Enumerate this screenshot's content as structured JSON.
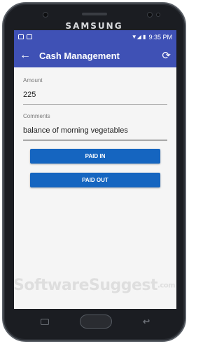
{
  "device": {
    "brand": "SAMSUNG"
  },
  "status_bar": {
    "time": "9:35 PM"
  },
  "app_bar": {
    "back_icon": "arrow-left-icon",
    "title": "Cash Management",
    "refresh_icon": "refresh-icon"
  },
  "form": {
    "amount_label": "Amount",
    "amount_value": "225",
    "comments_label": "Comments",
    "comments_value": "balance of morning vegetables",
    "paid_in_label": "PAID IN",
    "paid_out_label": "PAID OUT"
  },
  "watermark": {
    "text": "SoftwareSuggest",
    "suffix": ".com"
  },
  "colors": {
    "app_bar": "#3f51b5",
    "button": "#1565c0",
    "screen_bg": "#f5f5f5"
  }
}
